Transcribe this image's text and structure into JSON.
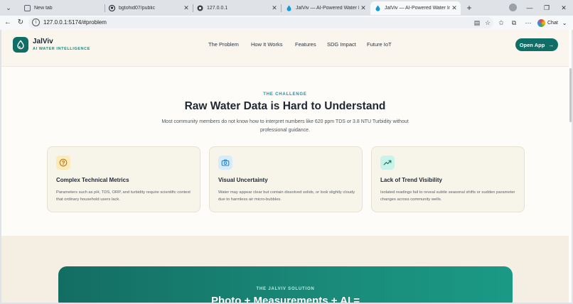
{
  "browser": {
    "tabs": [
      {
        "title": "New tab",
        "favicon": "new-tab-icon",
        "active": false
      },
      {
        "title": "bgtohid07/public",
        "favicon": "github-icon",
        "active": false
      },
      {
        "title": "127.0.0.1",
        "favicon": "localhost-icon",
        "active": false
      },
      {
        "title": "JalViv — AI-Powered Water Intelli",
        "favicon": "water-drop-icon",
        "active": false
      },
      {
        "title": "JalViv — AI-Powered Water Intellig",
        "favicon": "water-drop-icon",
        "active": true
      }
    ],
    "url": "127.0.0.1:5174/#problem",
    "chat_label": "Chat"
  },
  "header": {
    "logo_name": "JalViv",
    "logo_tagline": "AI WATER INTELLIGENCE",
    "nav": [
      "The Problem",
      "How It Works",
      "Features",
      "SDG Impact",
      "Future IoT"
    ],
    "cta_label": "Open App",
    "accent_color": "#0f6e66"
  },
  "problem": {
    "eyebrow": "THE CHALLENGE",
    "title": "Raw Water Data is Hard to Understand",
    "subtitle": "Most community members do not know how to interpret numbers like 620 ppm TDS or 3.8 NTU Turbidity without professional guidance.",
    "cards": [
      {
        "icon": "question-circle-icon",
        "icon_color": "#b7791f",
        "icon_bg": "#fdebb8",
        "title": "Complex Technical Metrics",
        "body": "Parameters such as pH, TDS, ORP, and turbidity require scientific context that ordinary household users lack."
      },
      {
        "icon": "camera-icon",
        "icon_color": "#2b83c6",
        "icon_bg": "#d6ecfb",
        "title": "Visual Uncertainty",
        "body": "Water may appear clear but contain dissolved solids, or look slightly cloudy due to harmless air micro-bubbles."
      },
      {
        "icon": "trending-up-icon",
        "icon_color": "#0f7d70",
        "icon_bg": "#c9f2e8",
        "title": "Lack of Trend Visibility",
        "body": "Isolated readings fail to reveal subtle seasonal shifts or sudden parameter changes across community wells."
      }
    ]
  },
  "solution": {
    "eyebrow": "THE JALVIV SOLUTION",
    "title": "Photo + Measurements + AI ="
  }
}
